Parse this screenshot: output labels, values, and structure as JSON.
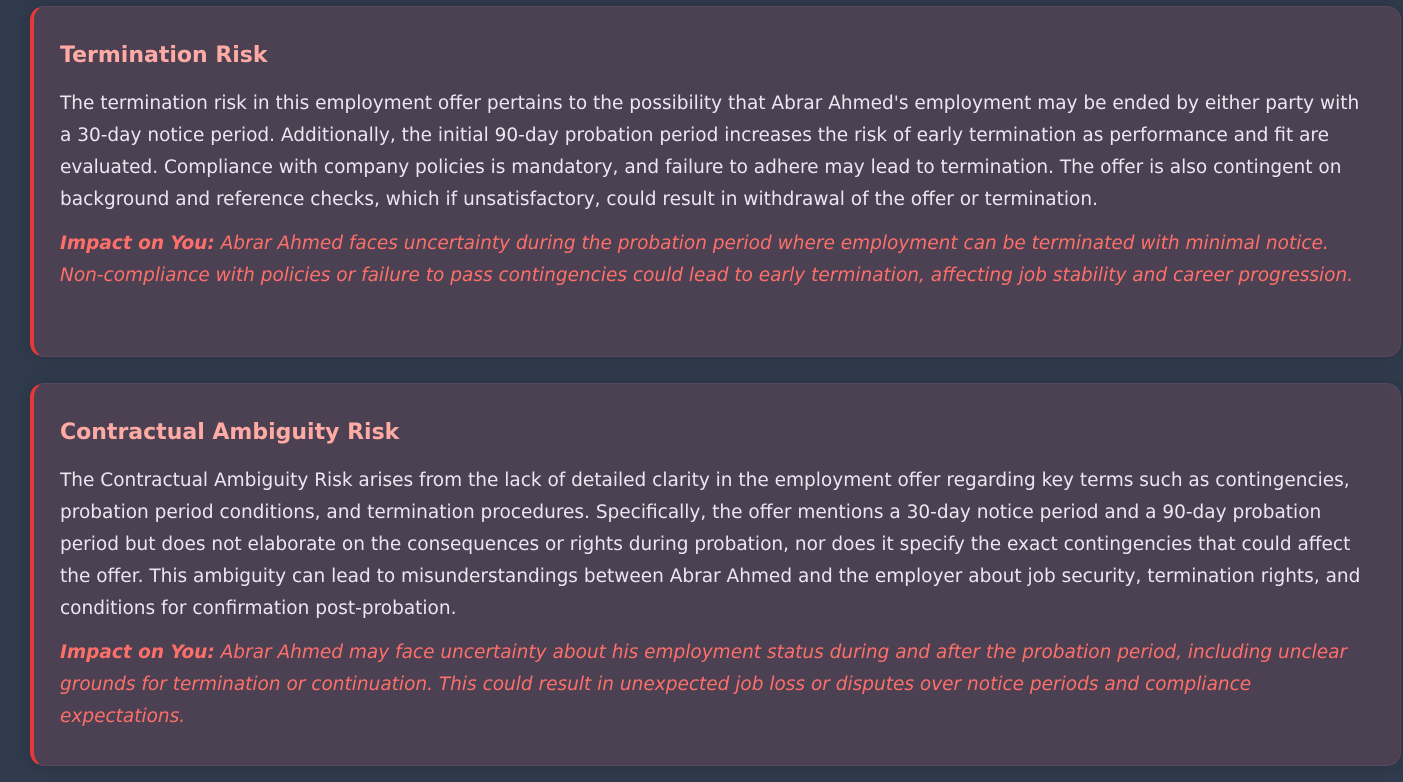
{
  "risks": [
    {
      "title": "Termination Risk",
      "description": "The termination risk in this employment offer pertains to the possibility that Abrar Ahmed's employment may be ended by either party with a 30-day notice period. Additionally, the initial 90-day probation period increases the risk of early termination as performance and fit are evaluated. Compliance with company policies is mandatory, and failure to adhere may lead to termination. The offer is also contingent on background and reference checks, which if unsatisfactory, could result in withdrawal of the offer or termination.",
      "impact_label": "Impact on You:",
      "impact_text": " Abrar Ahmed faces uncertainty during the probation period where employment can be terminated with minimal notice. Non-compliance with policies or failure to pass contingencies could lead to early termination, affecting job stability and career progression."
    },
    {
      "title": "Contractual Ambiguity Risk",
      "description": "The Contractual Ambiguity Risk arises from the lack of detailed clarity in the employment offer regarding key terms such as contingencies, probation period conditions, and termination procedures. Specifically, the offer mentions a 30-day notice period and a 90-day probation period but does not elaborate on the consequences or rights during probation, nor does it specify the exact contingencies that could affect the offer. This ambiguity can lead to misunderstandings between Abrar Ahmed and the employer about job security, termination rights, and conditions for confirmation post-probation.",
      "impact_label": "Impact on You:",
      "impact_text": " Abrar Ahmed may face uncertainty about his employment status during and after the probation period, including unclear grounds for termination or continuation. This could result in unexpected job loss or disputes over notice periods and compliance expectations."
    }
  ],
  "colors": {
    "background": "#303b4d",
    "card": "#4b4152",
    "accent_border": "#e5383b",
    "title": "#ffaaa4",
    "impact": "#ff6f6a",
    "text": "#ece6ef"
  }
}
